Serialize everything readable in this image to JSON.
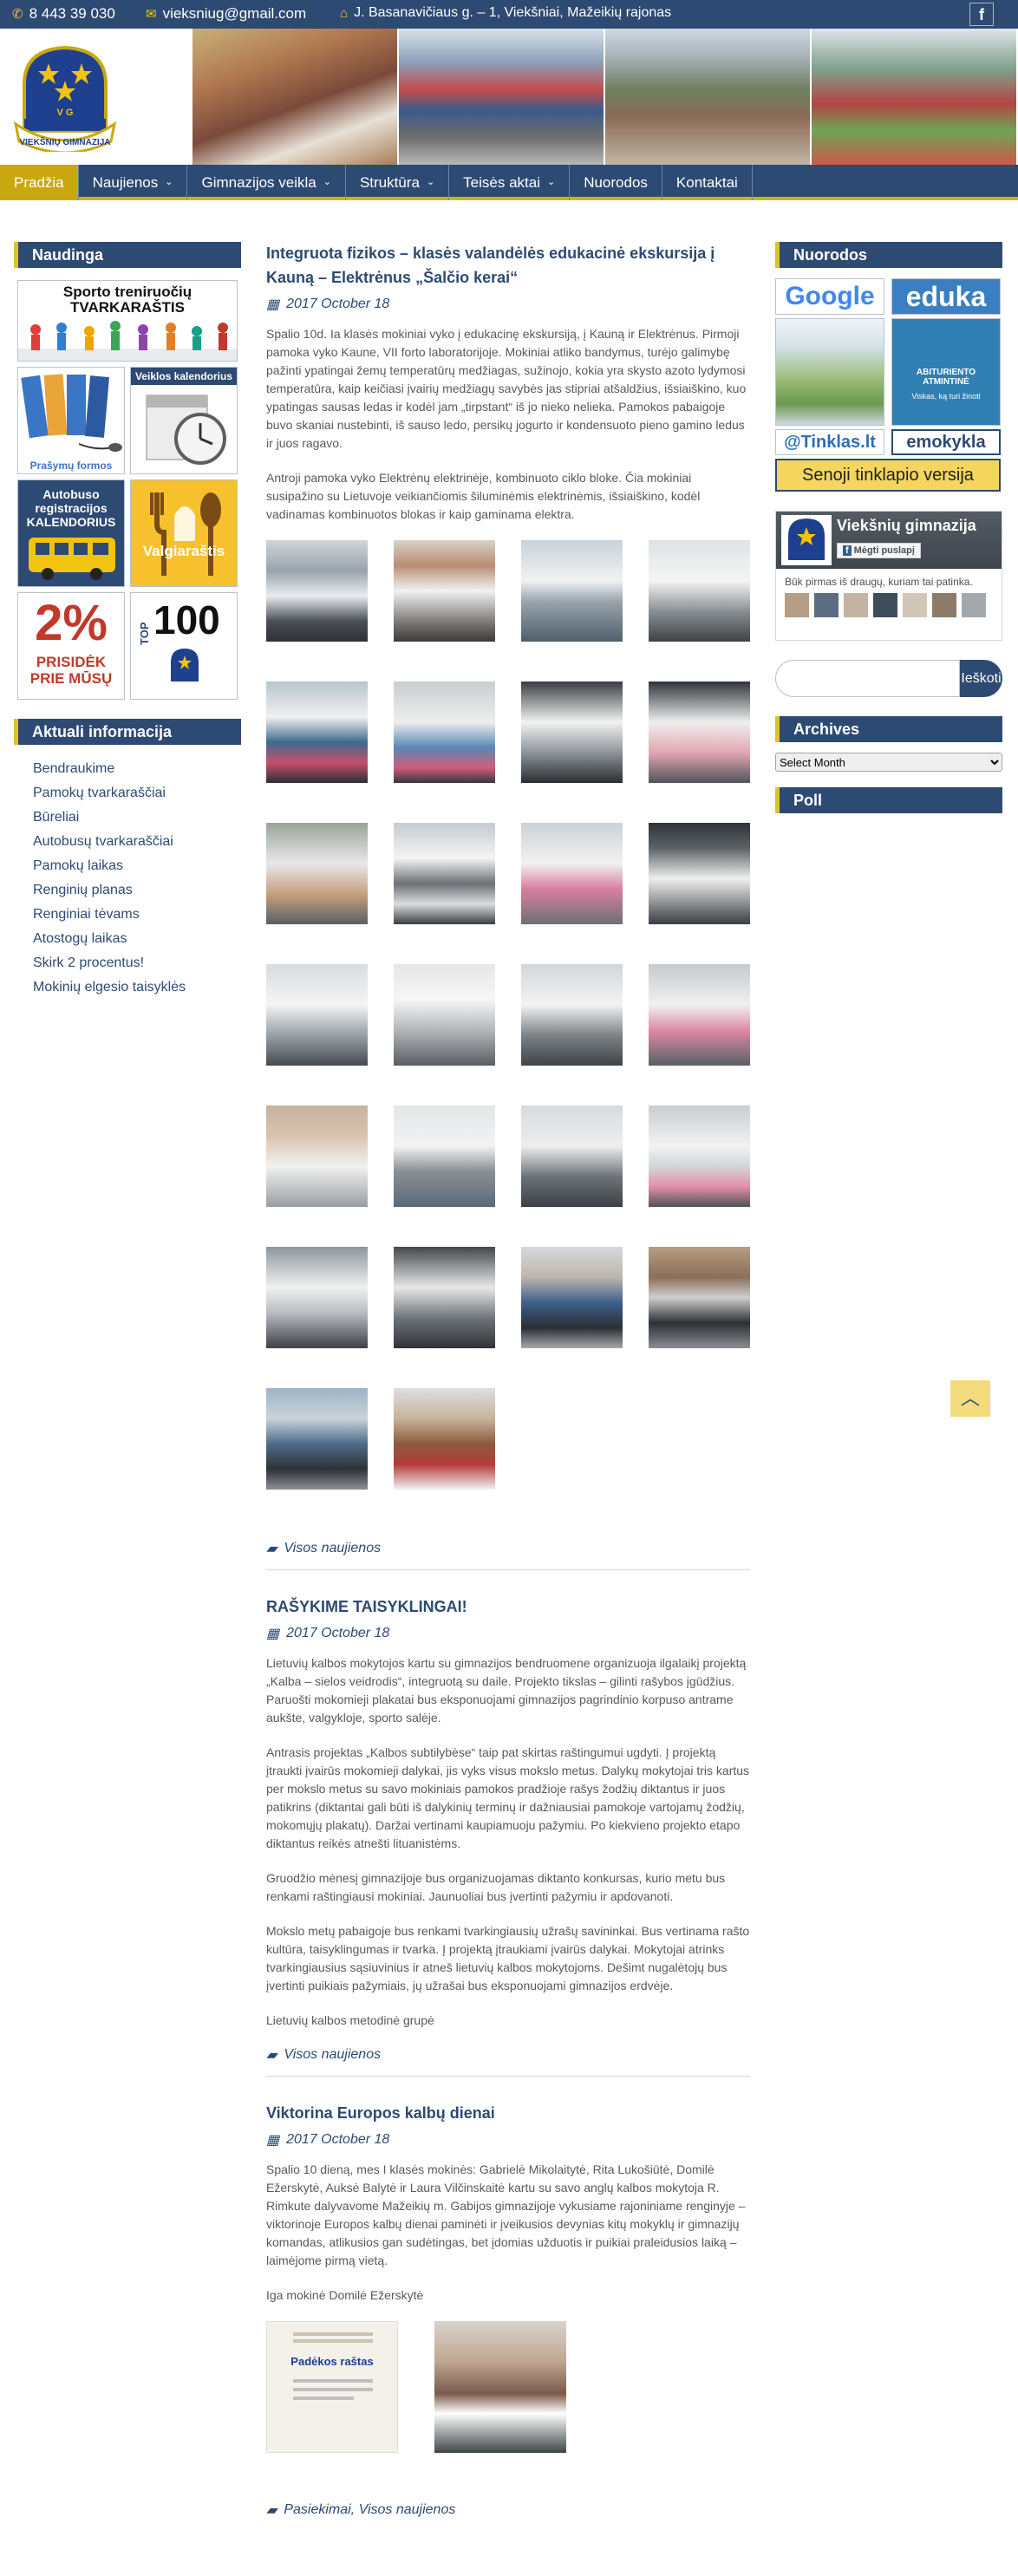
{
  "topbar": {
    "phone": "8 443 39 030",
    "email": "vieksniug@gmail.com",
    "address": "J. Basanavičiaus g. – 1, Viekšniai, Mažeikių rajonas",
    "social": "f"
  },
  "logo": {
    "top_text": "V  G",
    "bottom_text": "VIEKŠNIŲ GIMNAZIJA"
  },
  "nav": [
    {
      "label": "Pradžia",
      "dropdown": false,
      "active": true
    },
    {
      "label": "Naujienos",
      "dropdown": true
    },
    {
      "label": "Gimnazijos veikla",
      "dropdown": true
    },
    {
      "label": "Struktūra",
      "dropdown": true
    },
    {
      "label": "Teisės aktai",
      "dropdown": true
    },
    {
      "label": "Nuorodos",
      "dropdown": false
    },
    {
      "label": "Kontaktai",
      "dropdown": false
    }
  ],
  "left_sidebar": {
    "naudinga_title": "Naudinga",
    "banners": {
      "sport": "Sporto treniruočių TVARKARAŠTIS",
      "forms": "Prašymų formos",
      "calendar": "Veiklos kalendorius",
      "bus_line1": "Autobuso",
      "bus_line2": "registracijos",
      "bus_line3": "KALENDORIUS",
      "menu": "Valgiaraštis",
      "percent": "2%",
      "percent_sub": "PRISIDĖK PRIE MŪSŲ",
      "top": "TOP",
      "top_num": "100"
    },
    "aktuali_title": "Aktuali informacija",
    "links": [
      "Bendraukime",
      "Pamokų tvarkaraščiai",
      "Būreliai",
      "Autobusų tvarkaraščiai",
      "Pamokų laikas",
      "Renginių planas",
      "Renginiai tėvams",
      "Atostogų laikas",
      "Skirk 2 procentus!",
      "Mokinių elgesio taisyklės"
    ]
  },
  "right_sidebar": {
    "nuorodos_title": "Nuorodos",
    "google": "Google",
    "eduka": "eduka",
    "abit_title": "ABITURIENTO ATMINTINĖ",
    "abit_sub": "Viskas, ką turi žinoti",
    "tinklas": "@Tinklas.lt",
    "emokykla": "emokykla",
    "senoji": "Senoji tinklapio versija",
    "fb_name": "Viekšnių gimnazija",
    "fb_like": "Mėgti puslapį",
    "fb_friends": "Būk pirmas iš draugų, kuriam tai patinka.",
    "search_placeholder": "",
    "search_button": "Ieškoti",
    "archives_title": "Archives",
    "archives_select": "Select Month",
    "poll_title": "Poll"
  },
  "posts": [
    {
      "title": "Integruota fizikos – klasės valandėlės edukacinė ekskursija į Kauną – Elektrėnus „Šalčio kerai“",
      "date": "2017 October 18",
      "paragraphs": [
        "Spalio 10d. Ia klasės mokiniai vyko į edukacinę ekskursiją, į Kauną ir Elektrėnus. Pirmoji pamoka  vyko Kaune, VII forto laboratorijoje. Mokiniai atliko bandymus, turėjo galimybę pažinti ypatingai žemų temperatūrų medžiagas, sužinojo, kokia yra skysto azoto lydymosi temperatūra, kaip keičiasi įvairių medžiagų savybės jas stipriai atšaldžius, išsiaiškino, kuo ypatingas sausas ledas ir kodėl jam „tirpstant“ iš jo nieko nelieka. Pamokos pabaigoje buvo  skaniai nustebinti, iš sauso ledo, persikų jogurto ir kondensuoto pieno gamino ledus ir juos ragavo.",
        "Antroji pamoka vyko Elektrėnų elektrinėje, kombinuoto ciklo bloke. Čia mokiniai susipažino su Lietuvoje veikiančiomis šiluminėmis elektrinėmis, išsiaiškino, kodėl vadinamas kombinuotos blokas ir kaip gaminama elektra."
      ],
      "categories": "Visos naujienos"
    },
    {
      "title": "RAŠYKIME TAISYKLINGAI!",
      "date": "2017 October 18",
      "paragraphs": [
        "Lietuvių kalbos mokytojos kartu su gimnazijos bendruomene organizuoja ilgalaikį projektą „Kalba – sielos veidrodis“, integruotą su daile. Projekto tikslas – gilinti rašybos įgūdžius. Paruošti mokomieji plakatai bus eksponuojami gimnazijos pagrindinio korpuso antrame aukšte, valgykloje, sporto salėje.",
        "Antrasis projektas „Kalbos subtilybėse“ taip pat skirtas raštingumui ugdyti. Į projektą įtraukti įvairūs mokomieji dalykai, jis vyks visus mokslo metus. Dalykų mokytojai  tris kartus per mokslo metus su savo mokiniais pamokos pradžioje rašys žodžių diktantus ir juos patikrins (diktantai gali būti iš dalykinių terminų ir dažniausiai pamokoje vartojamų žodžių, mokomųjų plakatų).  Daržai vertinami kaupiamuoju pažymiu. Po kiekvieno projekto etapo diktantus reikės atnešti lituanistėms.",
        "Gruodžio mėnesį gimnazijoje bus organizuojamas diktanto konkursas, kurio metu bus renkami raštingiausi mokiniai. Jaunuoliai bus įvertinti pažymiu ir apdovanoti.",
        "Mokslo metų pabaigoje bus renkami tvarkingiausių užrašų savininkai. Bus vertinama rašto kultūra, taisyklingumas ir tvarka. Į projektą įtraukiami įvairūs dalykai. Mokytojai atrinks tvarkingiausius sąsiuvinius ir atneš lietuvių kalbos mokytojoms. Dešimt nugalėtojų bus įvertinti puikiais pažymiais, jų užrašai bus eksponuojami gimnazijos erdvėje.",
        "Lietuvių kalbos metodinė grupė"
      ],
      "categories": "Visos naujienos"
    },
    {
      "title": "Viktorina Europos  kalbų dienai",
      "date": "2017 October 18",
      "paragraphs": [
        "Spalio 10 dieną, mes I  klasės mokinės: Gabrielė Mikolaitytė, Rita Lukošiūtė, Domilė Ežerskytė, Auksė Balytė ir Laura Vilčinskaitė kartu su savo anglų kalbos mokytoja R. Rimkute dalyvavome  Mažeikių m.  Gabijos gimnazijoje vykusiame rajoniniame renginyje – viktorinoje Europos  kalbų dienai paminėti ir įveikusios devynias kitų mokyklų ir gimnazijų komandas, atlikusios gan sudėtingas, bet įdomias  užduotis ir puikiai praleidusios laiką – laimėjome pirmą vietą.",
        "Iga mokinė Domilė Ežerskytė"
      ],
      "certificate_title": "Padėkos raštas",
      "categories": "Pasiekimai, Visos naujienos"
    }
  ]
}
